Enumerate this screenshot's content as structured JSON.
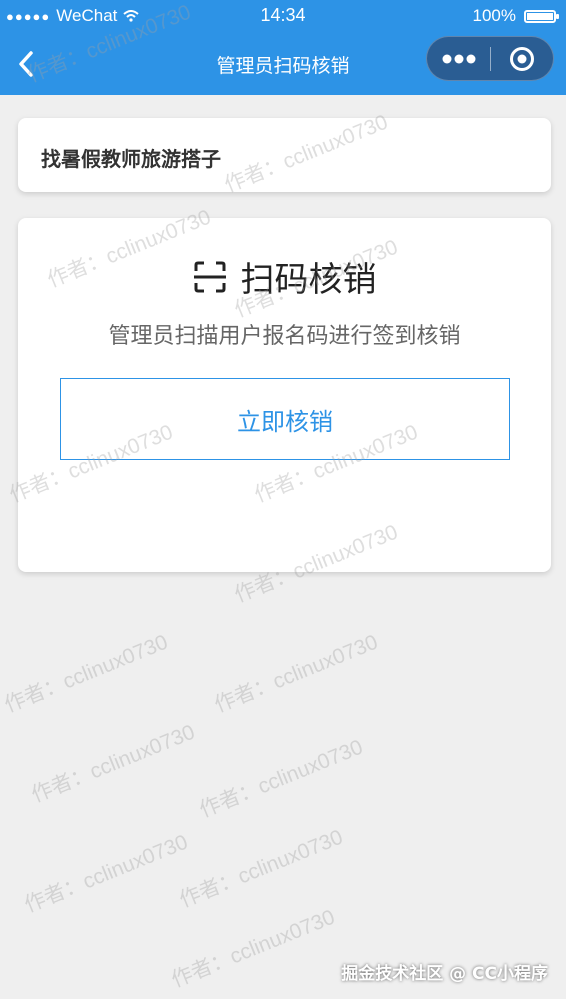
{
  "status_bar": {
    "carrier": "WeChat",
    "time": "14:34",
    "battery": "100%"
  },
  "nav": {
    "title": "管理员扫码核销"
  },
  "event": {
    "title": "找暑假教师旅游搭子"
  },
  "scan": {
    "heading": "扫码核销",
    "description": "管理员扫描用户报名码进行签到核销",
    "button_label": "立即核销"
  },
  "watermark": "作者：cclinux0730",
  "footer": "掘金技术社区 @ CC小程序",
  "colors": {
    "primary": "#2d93e6",
    "background": "#efefef"
  }
}
